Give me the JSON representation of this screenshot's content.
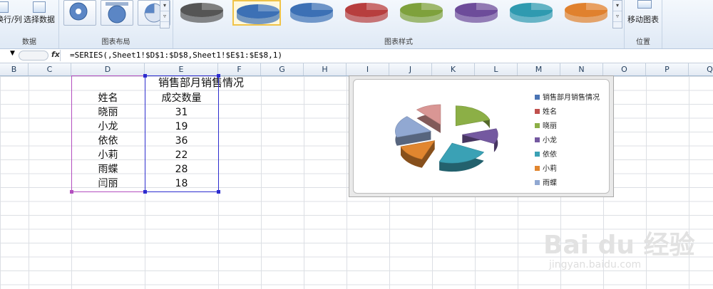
{
  "ribbon": {
    "data_group": {
      "label": "数据",
      "switch_row_col": "换行/列",
      "select_data": "选择数据"
    },
    "layout_group": {
      "label": "图表布局"
    },
    "style_group": {
      "label": "图表样式"
    },
    "location_group": {
      "label": "位置",
      "move_chart": "移动图表"
    },
    "style_colors": [
      "#555555",
      "#3c70b5",
      "#3c70b5",
      "#b73e3e",
      "#7ea13c",
      "#6d4c9a",
      "#2f9ab0",
      "#e0812e"
    ]
  },
  "formula_bar": {
    "fx": "fx",
    "formula": "=SERIES(,Sheet1!$D$1:$D$8,Sheet1!$E$1:$E$8,1)"
  },
  "columns": [
    "B",
    "C",
    "D",
    "E",
    "F",
    "G",
    "H",
    "I",
    "J",
    "K",
    "L",
    "M",
    "N",
    "O",
    "P",
    "Q"
  ],
  "sheet": {
    "title": "销售部月销售情况",
    "header": {
      "name": "姓名",
      "qty": "成交数量"
    },
    "rows": [
      {
        "name": "晓丽",
        "qty": "31"
      },
      {
        "name": "小龙",
        "qty": "19"
      },
      {
        "name": "依依",
        "qty": "36"
      },
      {
        "name": "小莉",
        "qty": "22"
      },
      {
        "name": "雨蝶",
        "qty": "28"
      },
      {
        "name": "闫丽",
        "qty": "18"
      }
    ]
  },
  "chart_data": {
    "type": "pie",
    "title": "",
    "categories": [
      "晓丽",
      "小龙",
      "依依",
      "小莉",
      "雨蝶",
      "闫丽"
    ],
    "values": [
      31,
      19,
      36,
      22,
      28,
      18
    ],
    "legend": [
      {
        "label": "销售部月销售情况",
        "color": "#4a74b4"
      },
      {
        "label": "姓名",
        "color": "#c0504d"
      },
      {
        "label": "晓丽",
        "color": "#8caf46"
      },
      {
        "label": "小龙",
        "color": "#7459a0"
      },
      {
        "label": "依依",
        "color": "#3aa1b5"
      },
      {
        "label": "小莉",
        "color": "#e1862f"
      },
      {
        "label": "雨蝶",
        "color": "#91a8d2"
      }
    ],
    "slice_colors": [
      "#8caf46",
      "#7459a0",
      "#3aa1b5",
      "#e1862f",
      "#91a8d2",
      "#d99694"
    ],
    "legend_position": "right",
    "exploded": true,
    "style": "3d"
  },
  "watermark": {
    "brand": "Bai du 经验",
    "url": "jingyan.baidu.com"
  }
}
